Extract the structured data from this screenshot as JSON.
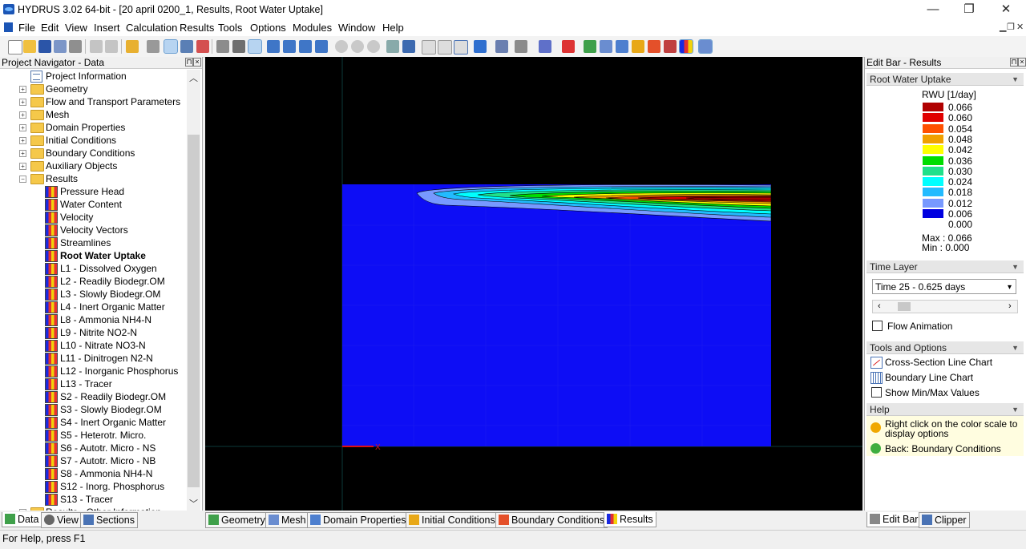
{
  "window": {
    "title": "HYDRUS 3.02 64-bit - [20 april 0200_1, Results, Root Water Uptake]",
    "controls": [
      "—",
      "❐",
      "✕"
    ]
  },
  "menu": [
    "File",
    "Edit",
    "View",
    "Insert",
    "Calculation",
    "Results",
    "Tools",
    "Options",
    "Modules",
    "Window",
    "Help"
  ],
  "mdi_controls": [
    "▁",
    "❐",
    "✕"
  ],
  "navigator": {
    "title": "Project Navigator - Data",
    "items": [
      {
        "label": "Project Information",
        "level": 1,
        "icon": "doc-icon",
        "expander": ""
      },
      {
        "label": "Geometry",
        "level": 1,
        "icon": "folder-icon",
        "expander": "+"
      },
      {
        "label": "Flow and Transport Parameters",
        "level": 1,
        "icon": "folder-icon",
        "expander": "+"
      },
      {
        "label": "Mesh",
        "level": 1,
        "icon": "folder-icon",
        "expander": "+"
      },
      {
        "label": "Domain Properties",
        "level": 1,
        "icon": "folder-icon",
        "expander": "+"
      },
      {
        "label": "Initial Conditions",
        "level": 1,
        "icon": "folder-icon",
        "expander": "+"
      },
      {
        "label": "Boundary Conditions",
        "level": 1,
        "icon": "folder-icon",
        "expander": "+"
      },
      {
        "label": "Auxiliary Objects",
        "level": 1,
        "icon": "folder-icon",
        "expander": "+"
      },
      {
        "label": "Results",
        "level": 1,
        "icon": "folder-icon",
        "expander": "−"
      },
      {
        "label": "Pressure Head",
        "level": 2,
        "icon": "result-icon"
      },
      {
        "label": "Water Content",
        "level": 2,
        "icon": "result-icon"
      },
      {
        "label": "Velocity",
        "level": 2,
        "icon": "result-icon"
      },
      {
        "label": "Velocity Vectors",
        "level": 2,
        "icon": "result-icon"
      },
      {
        "label": "Streamlines",
        "level": 2,
        "icon": "result-icon"
      },
      {
        "label": "Root Water Uptake",
        "level": 2,
        "icon": "result-icon",
        "selected": true
      },
      {
        "label": "L1 - Dissolved Oxygen",
        "level": 2,
        "icon": "result-icon"
      },
      {
        "label": "L2 - Readily Biodegr.OM",
        "level": 2,
        "icon": "result-icon"
      },
      {
        "label": "L3 - Slowly Biodegr.OM",
        "level": 2,
        "icon": "result-icon"
      },
      {
        "label": "L4 - Inert Organic Matter",
        "level": 2,
        "icon": "result-icon"
      },
      {
        "label": "L8 - Ammonia NH4-N",
        "level": 2,
        "icon": "result-icon"
      },
      {
        "label": "L9 - Nitrite NO2-N",
        "level": 2,
        "icon": "result-icon"
      },
      {
        "label": "L10 - Nitrate NO3-N",
        "level": 2,
        "icon": "result-icon"
      },
      {
        "label": "L11 - Dinitrogen N2-N",
        "level": 2,
        "icon": "result-icon"
      },
      {
        "label": "L12 - Inorganic Phosphorus",
        "level": 2,
        "icon": "result-icon"
      },
      {
        "label": "L13 - Tracer",
        "level": 2,
        "icon": "result-icon"
      },
      {
        "label": "S2 - Readily Biodegr.OM",
        "level": 2,
        "icon": "result-icon"
      },
      {
        "label": "S3 - Slowly Biodegr.OM",
        "level": 2,
        "icon": "result-icon"
      },
      {
        "label": "S4 - Inert Organic Matter",
        "level": 2,
        "icon": "result-icon"
      },
      {
        "label": "S5 - Heterotr. Micro.",
        "level": 2,
        "icon": "result-icon"
      },
      {
        "label": "S6 - Autotr. Micro - NS",
        "level": 2,
        "icon": "result-icon"
      },
      {
        "label": "S7 - Autotr. Micro - NB",
        "level": 2,
        "icon": "result-icon"
      },
      {
        "label": "S8 - Ammonia NH4-N",
        "level": 2,
        "icon": "result-icon"
      },
      {
        "label": "S12 - Inorg. Phosphorus",
        "level": 2,
        "icon": "result-icon"
      },
      {
        "label": "S13 - Tracer",
        "level": 2,
        "icon": "result-icon"
      },
      {
        "label": "Results - Other Information",
        "level": 1,
        "icon": "folder-icon",
        "expander": "+"
      }
    ],
    "tabs": [
      "Data",
      "View",
      "Sections"
    ]
  },
  "view_tabs": [
    "Geometry",
    "Mesh",
    "Domain Properties",
    "Initial Conditions",
    "Boundary Conditions",
    "Results"
  ],
  "axis": {
    "x_label": "X"
  },
  "edit_bar": {
    "title": "Edit Bar - Results",
    "section_rwu": "Root Water Uptake",
    "legend_title": "RWU [1/day]",
    "legend": [
      {
        "value": "0.066",
        "color": "#b00000"
      },
      {
        "value": "0.060",
        "color": "#e00000"
      },
      {
        "value": "0.054",
        "color": "#ff5000"
      },
      {
        "value": "0.048",
        "color": "#f0a000"
      },
      {
        "value": "0.042",
        "color": "#ffff00"
      },
      {
        "value": "0.036",
        "color": "#00dd00"
      },
      {
        "value": "0.030",
        "color": "#20e08a"
      },
      {
        "value": "0.024",
        "color": "#00ffff"
      },
      {
        "value": "0.018",
        "color": "#22bbff"
      },
      {
        "value": "0.012",
        "color": "#7799ff"
      },
      {
        "value": "0.006",
        "color": "#0000e0"
      },
      {
        "value": "0.000",
        "color": "#ffffff"
      }
    ],
    "max_text": "Max :  0.066",
    "min_text": "Min  :  0.000",
    "section_time": "Time Layer",
    "time_value": "Time 25 - 0.625 days",
    "flow_animation": "Flow Animation",
    "section_tools": "Tools and Options",
    "tools": [
      "Cross-Section Line Chart",
      "Boundary Line Chart",
      "Show Min/Max Values"
    ],
    "section_help": "Help",
    "help_text_1": "Right click on the color scale to",
    "help_text_2": "display options",
    "help_back": "Back: Boundary Conditions",
    "tabs": [
      "Edit Bar",
      "Clipper"
    ]
  },
  "status": "For Help, press F1"
}
